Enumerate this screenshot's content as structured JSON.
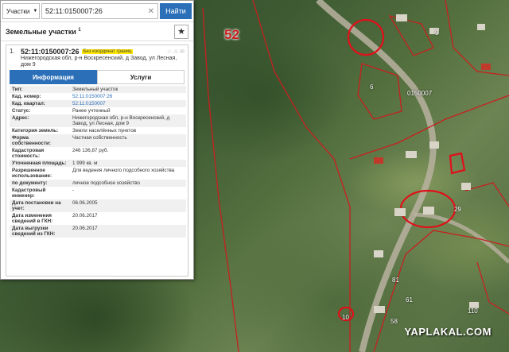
{
  "search": {
    "category": "Участки",
    "query": "52:11:0150007:26",
    "clear_glyph": "✕",
    "button": "Найти"
  },
  "section": {
    "title": "Земельные участки",
    "count_sup": "1",
    "star_glyph": "★"
  },
  "item": {
    "number": "1.",
    "title": "52:11:0150007:26",
    "badge": "Без координат границ",
    "icons": "☆ ⚠ ✉",
    "address": "Нижегородская обл, р-н Воскресенский, д Завод, ул Лесная, дом 9"
  },
  "tabs": [
    {
      "label": "Информация",
      "active": true
    },
    {
      "label": "Услуги",
      "active": false
    }
  ],
  "props": [
    {
      "k": "Тип:",
      "v": "Земельный участок"
    },
    {
      "k": "Кад. номер:",
      "v": "52:11:0150007:26",
      "link": true
    },
    {
      "k": "Кад. квартал:",
      "v": "52:11:0150007",
      "link": true
    },
    {
      "k": "Статус:",
      "v": "Ранее учтенный"
    },
    {
      "k": "Адрес:",
      "v": "Нижегородская обл, р-н Воскресенский, д Завод, ул Лесная, дом 9"
    },
    {
      "k": "Категория земель:",
      "v": "Земли населённых пунктов"
    },
    {
      "k": "Форма собственности:",
      "v": "Частная собственность"
    },
    {
      "k": "Кадастровая стоимость:",
      "v": "246 136,87 руб."
    },
    {
      "k": "Уточненная площадь:",
      "v": "1 999 кв. м"
    },
    {
      "k": "Разрешенное использование:",
      "v": "Для ведения личного подсобного хозяйства"
    },
    {
      "k": "по документу:",
      "v": "личное подсобное хозяйство"
    },
    {
      "k": "Кадастровый инженер:",
      "v": "-"
    },
    {
      "k": "Дата постановки на учет:",
      "v": "06.06.2005"
    },
    {
      "k": "Дата изменения сведений в ГКН:",
      "v": "20.06.2017"
    },
    {
      "k": "Дата выгрузки сведений из ГКН:",
      "v": "20.06.2017"
    }
  ],
  "map": {
    "quarter_label": "52",
    "block_label": "0150007",
    "labels": [
      "61",
      "81",
      "10",
      "58",
      "110",
      "9",
      "29",
      "6"
    ],
    "watermark": "YAPLAKAL.COM"
  },
  "colors": {
    "accent": "#2a6fb8",
    "badge": "#ffe800",
    "boundary": "#c72020"
  }
}
